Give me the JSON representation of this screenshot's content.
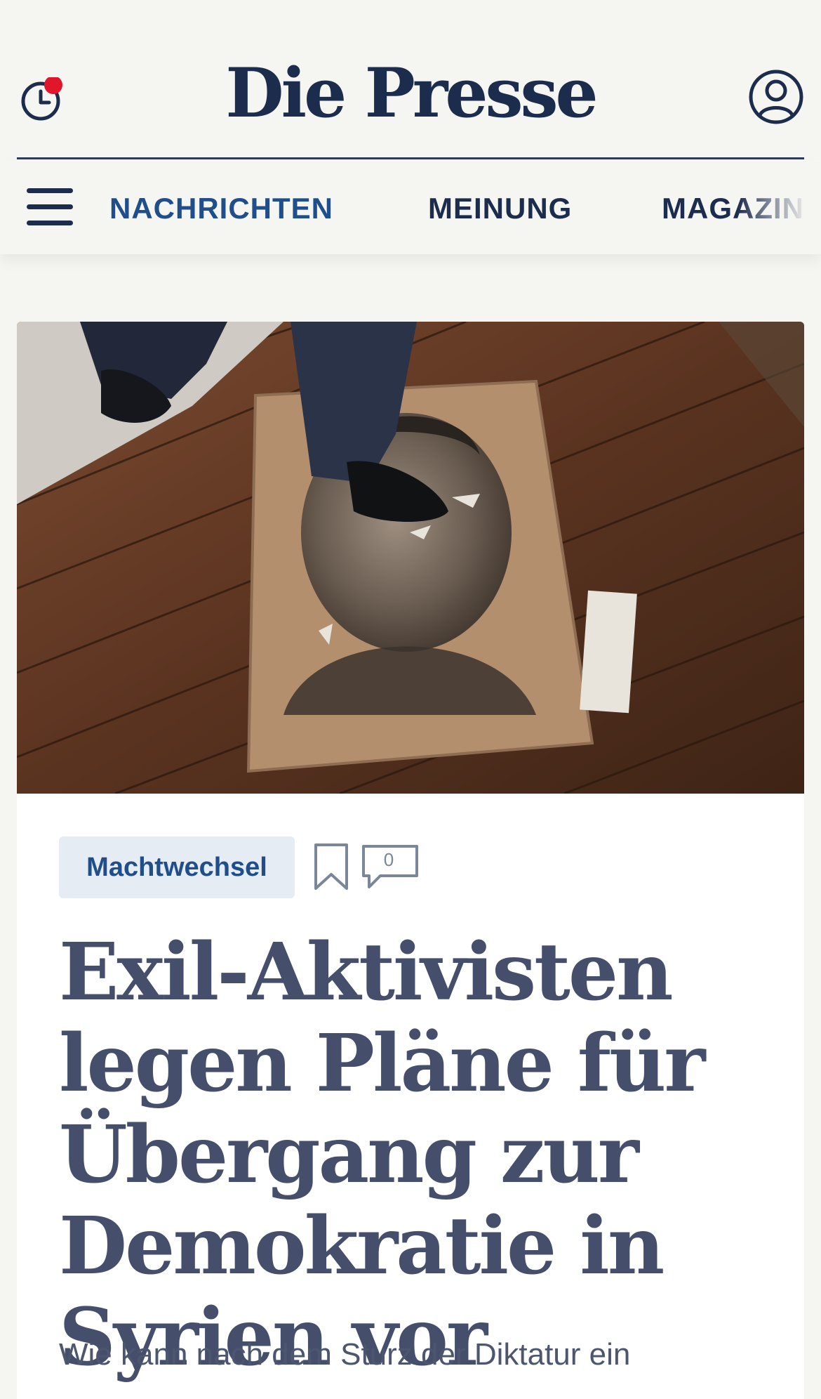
{
  "header": {
    "logo": "Die Presse",
    "notification_dot_color": "#e0162b",
    "clock_icon": "clock-icon",
    "user_icon": "user-account-icon"
  },
  "nav": {
    "menu_icon": "hamburger-menu-icon",
    "items": [
      {
        "label": "NACHRICHTEN",
        "active": true
      },
      {
        "label": "MEINUNG",
        "active": false
      },
      {
        "label": "MAGAZIN",
        "active": false
      }
    ]
  },
  "article": {
    "image_icon": "article-photo",
    "tag": "Machtwechsel",
    "bookmark_icon": "bookmark-icon",
    "comment_icon": "comment-icon",
    "comment_count": "0",
    "headline": "Exil-Aktivisten legen Pläne für Übergang zur Demokratie in Syrien vor",
    "teaser": "Wie kann nach dem Sturz der Diktatur ein"
  },
  "colors": {
    "brand_navy": "#1c2c4c",
    "accent_blue": "#1f4e8a",
    "headline_slate": "#454f6b",
    "background": "#f5f5f2"
  }
}
